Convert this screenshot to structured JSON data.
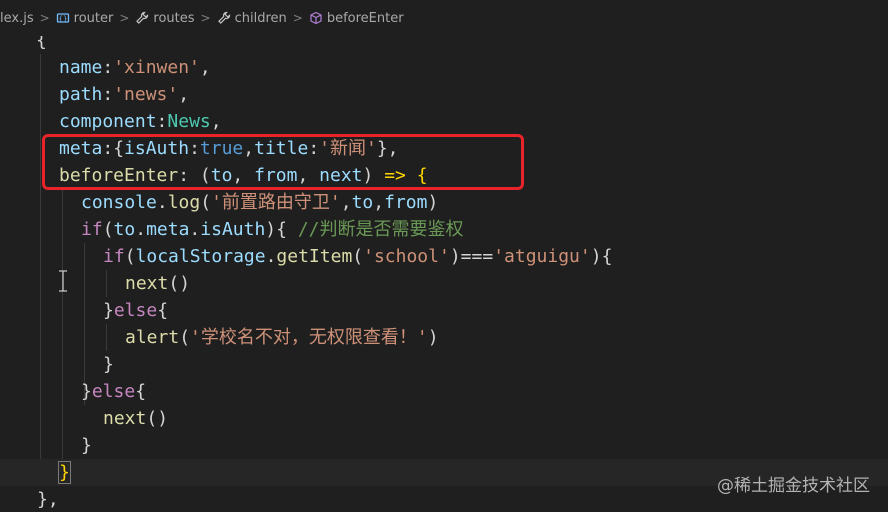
{
  "breadcrumb": {
    "items": [
      {
        "label": "lex.js",
        "icon": "none"
      },
      {
        "label": "router",
        "icon": "module-icon"
      },
      {
        "label": "routes",
        "icon": "wrench-icon"
      },
      {
        "label": "children",
        "icon": "wrench-icon"
      },
      {
        "label": "beforeEnter",
        "icon": "cube-icon"
      }
    ]
  },
  "code": {
    "l0": "{",
    "l1_key": "name",
    "l1_val": "'xinwen'",
    "l2_key": "path",
    "l2_val": "'news'",
    "l3_key": "component",
    "l3_val": "News",
    "l4_key": "meta",
    "l4_k1": "isAuth",
    "l4_v1": "true",
    "l4_k2": "title",
    "l4_v2": "'新闻'",
    "l5_key": "beforeEnter",
    "l5_a1": "to",
    "l5_a2": "from",
    "l5_a3": "next",
    "l6_obj": "console",
    "l6_fn": "log",
    "l6_str": "'前置路由守卫'",
    "l6_a1": "to",
    "l6_a2": "from",
    "l7_kw": "if",
    "l7_a": "to",
    "l7_b": "meta",
    "l7_c": "isAuth",
    "l7_cmt": "//判断是否需要鉴权",
    "l8_kw": "if",
    "l8_obj": "localStorage",
    "l8_fn": "getItem",
    "l8_s1": "'school'",
    "l8_s2": "'atguigu'",
    "l9_fn": "next",
    "l10_kw": "else",
    "l11_fn": "alert",
    "l11_str": "'学校名不对，无权限查看！'",
    "l12": "}",
    "l13_kw": "else",
    "l14_fn": "next",
    "l15": "}",
    "l16": "}",
    "l17": "},"
  },
  "watermark": "@稀土掘金技术社区",
  "colors": {
    "background": "#1f1f1f",
    "highlight_border": "#e8232a",
    "string": "#ce9178",
    "property": "#9cdcfe",
    "keyword": "#c586c0",
    "function": "#dcdcaa",
    "comment": "#6a9955"
  }
}
